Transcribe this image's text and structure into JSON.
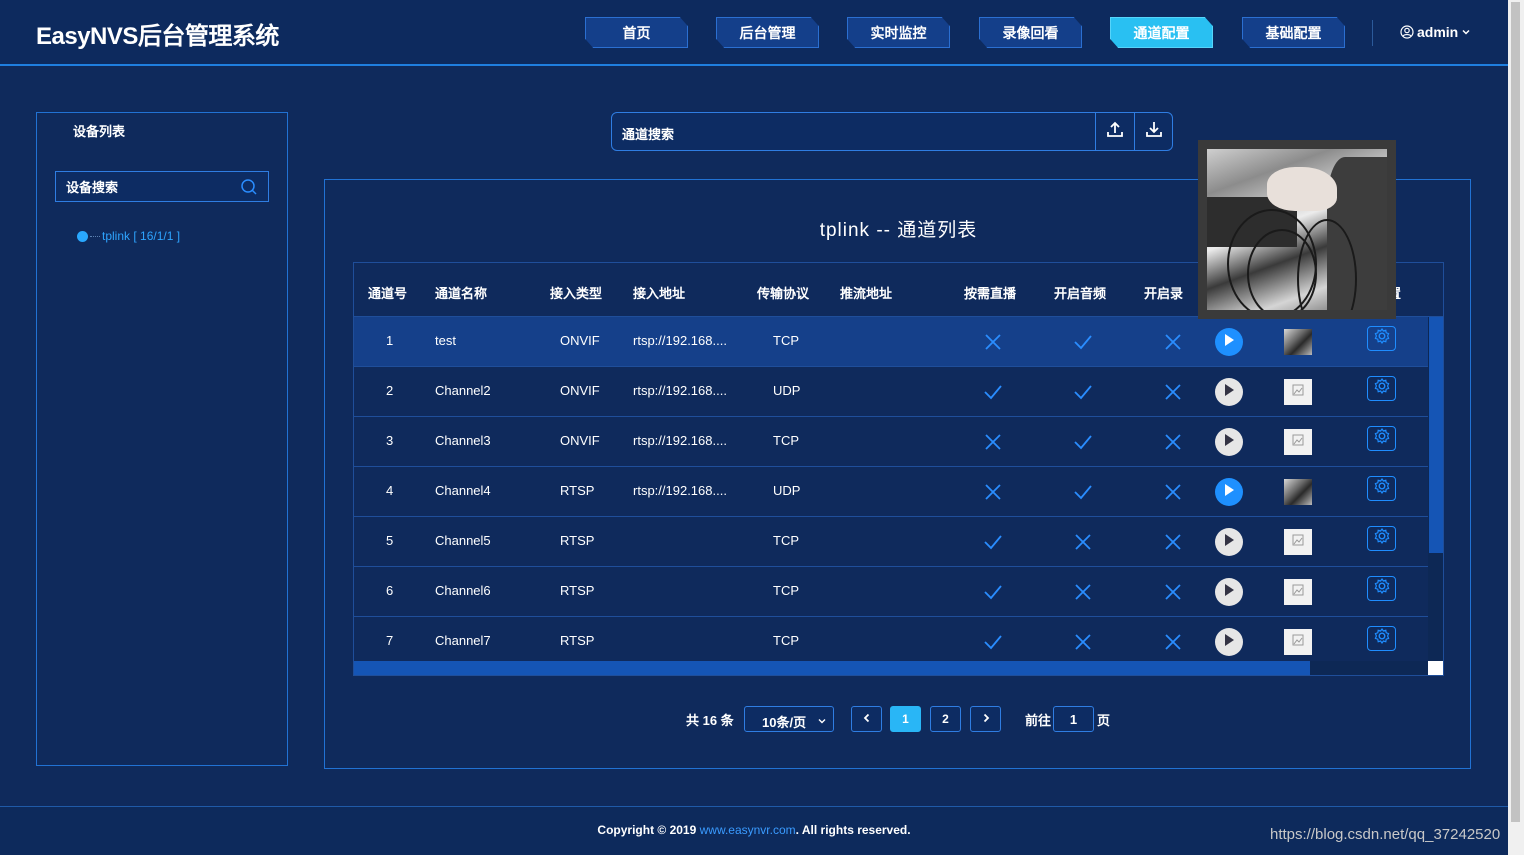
{
  "app": {
    "title": "EasyNVS后台管理系统"
  },
  "nav": {
    "items": [
      {
        "label": "首页"
      },
      {
        "label": "后台管理"
      },
      {
        "label": "实时监控"
      },
      {
        "label": "录像回看"
      },
      {
        "label": "通道配置",
        "active": true
      },
      {
        "label": "基础配置"
      }
    ],
    "user": "admin"
  },
  "sidebar": {
    "title": "设备列表",
    "search_placeholder": "设备搜索",
    "tree": [
      {
        "label": "tplink [ 16/1/1 ]"
      }
    ]
  },
  "channel_search": {
    "placeholder": "通道搜索"
  },
  "panel": {
    "title": "tplink -- 通道列表"
  },
  "table": {
    "headers": [
      "通道号",
      "通道名称",
      "接入类型",
      "接入地址",
      "传输协议",
      "推流地址",
      "按需直播",
      "开启音频",
      "开启录",
      "置"
    ],
    "rows": [
      {
        "id": "1",
        "name": "test",
        "type": "ONVIF",
        "addr": "rtsp://192.168....",
        "proto": "TCP",
        "ondemand": false,
        "audio": true,
        "record": false,
        "playing": true,
        "snapshot": "video",
        "highlighted": true
      },
      {
        "id": "2",
        "name": "Channel2",
        "type": "ONVIF",
        "addr": "rtsp://192.168....",
        "proto": "UDP",
        "ondemand": true,
        "audio": true,
        "record": false,
        "playing": false,
        "snapshot": "placeholder"
      },
      {
        "id": "3",
        "name": "Channel3",
        "type": "ONVIF",
        "addr": "rtsp://192.168....",
        "proto": "TCP",
        "ondemand": false,
        "audio": true,
        "record": false,
        "playing": false,
        "snapshot": "placeholder"
      },
      {
        "id": "4",
        "name": "Channel4",
        "type": "RTSP",
        "addr": "rtsp://192.168....",
        "proto": "UDP",
        "ondemand": false,
        "audio": true,
        "record": false,
        "playing": true,
        "snapshot": "video"
      },
      {
        "id": "5",
        "name": "Channel5",
        "type": "RTSP",
        "addr": "",
        "proto": "TCP",
        "ondemand": true,
        "audio": false,
        "record": false,
        "playing": false,
        "snapshot": "placeholder"
      },
      {
        "id": "6",
        "name": "Channel6",
        "type": "RTSP",
        "addr": "",
        "proto": "TCP",
        "ondemand": true,
        "audio": false,
        "record": false,
        "playing": false,
        "snapshot": "placeholder"
      },
      {
        "id": "7",
        "name": "Channel7",
        "type": "RTSP",
        "addr": "",
        "proto": "TCP",
        "ondemand": true,
        "audio": false,
        "record": false,
        "playing": false,
        "snapshot": "placeholder"
      }
    ]
  },
  "pagination": {
    "total": "共 16 条",
    "page_size": "10条/页",
    "pages": [
      "1",
      "2"
    ],
    "current": "1",
    "goto_label": "前往",
    "goto_value": "1",
    "goto_suffix": "页"
  },
  "footer": {
    "prefix": "Copyright © 2019 ",
    "link": "www.easynvr.com",
    "suffix": ". All rights reserved."
  },
  "watermark": "https://blog.csdn.net/qq_37242520",
  "colors": {
    "accent": "#29b6f6",
    "play_active": "#1e90ff",
    "check": "#2a8dff",
    "background": "#0f2a5c"
  }
}
